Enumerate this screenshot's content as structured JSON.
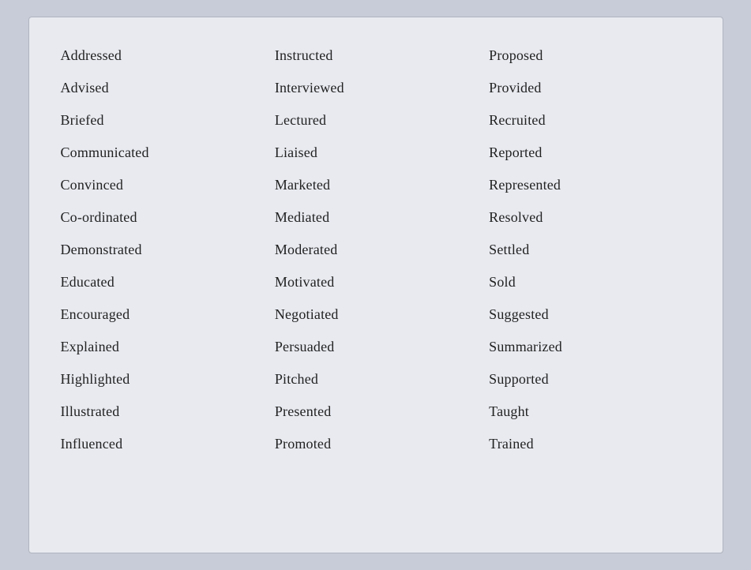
{
  "words": {
    "col1": [
      "Addressed",
      "Advised",
      "Briefed",
      "Communicated",
      "Convinced",
      "Co-ordinated",
      "Demonstrated",
      "Educated",
      "Encouraged",
      "Explained",
      "Highlighted",
      "Illustrated",
      "Influenced"
    ],
    "col2": [
      "Instructed",
      "Interviewed",
      "Lectured",
      "Liaised",
      "Marketed",
      "Mediated",
      "Moderated",
      "Motivated",
      "Negotiated",
      "Persuaded",
      "Pitched",
      "Presented",
      "Promoted"
    ],
    "col3": [
      "Proposed",
      "Provided",
      "Recruited",
      "Reported",
      "Represented",
      "Resolved",
      "Settled",
      "Sold",
      "Suggested",
      "Summarized",
      "Supported",
      "Taught",
      "Trained"
    ]
  }
}
